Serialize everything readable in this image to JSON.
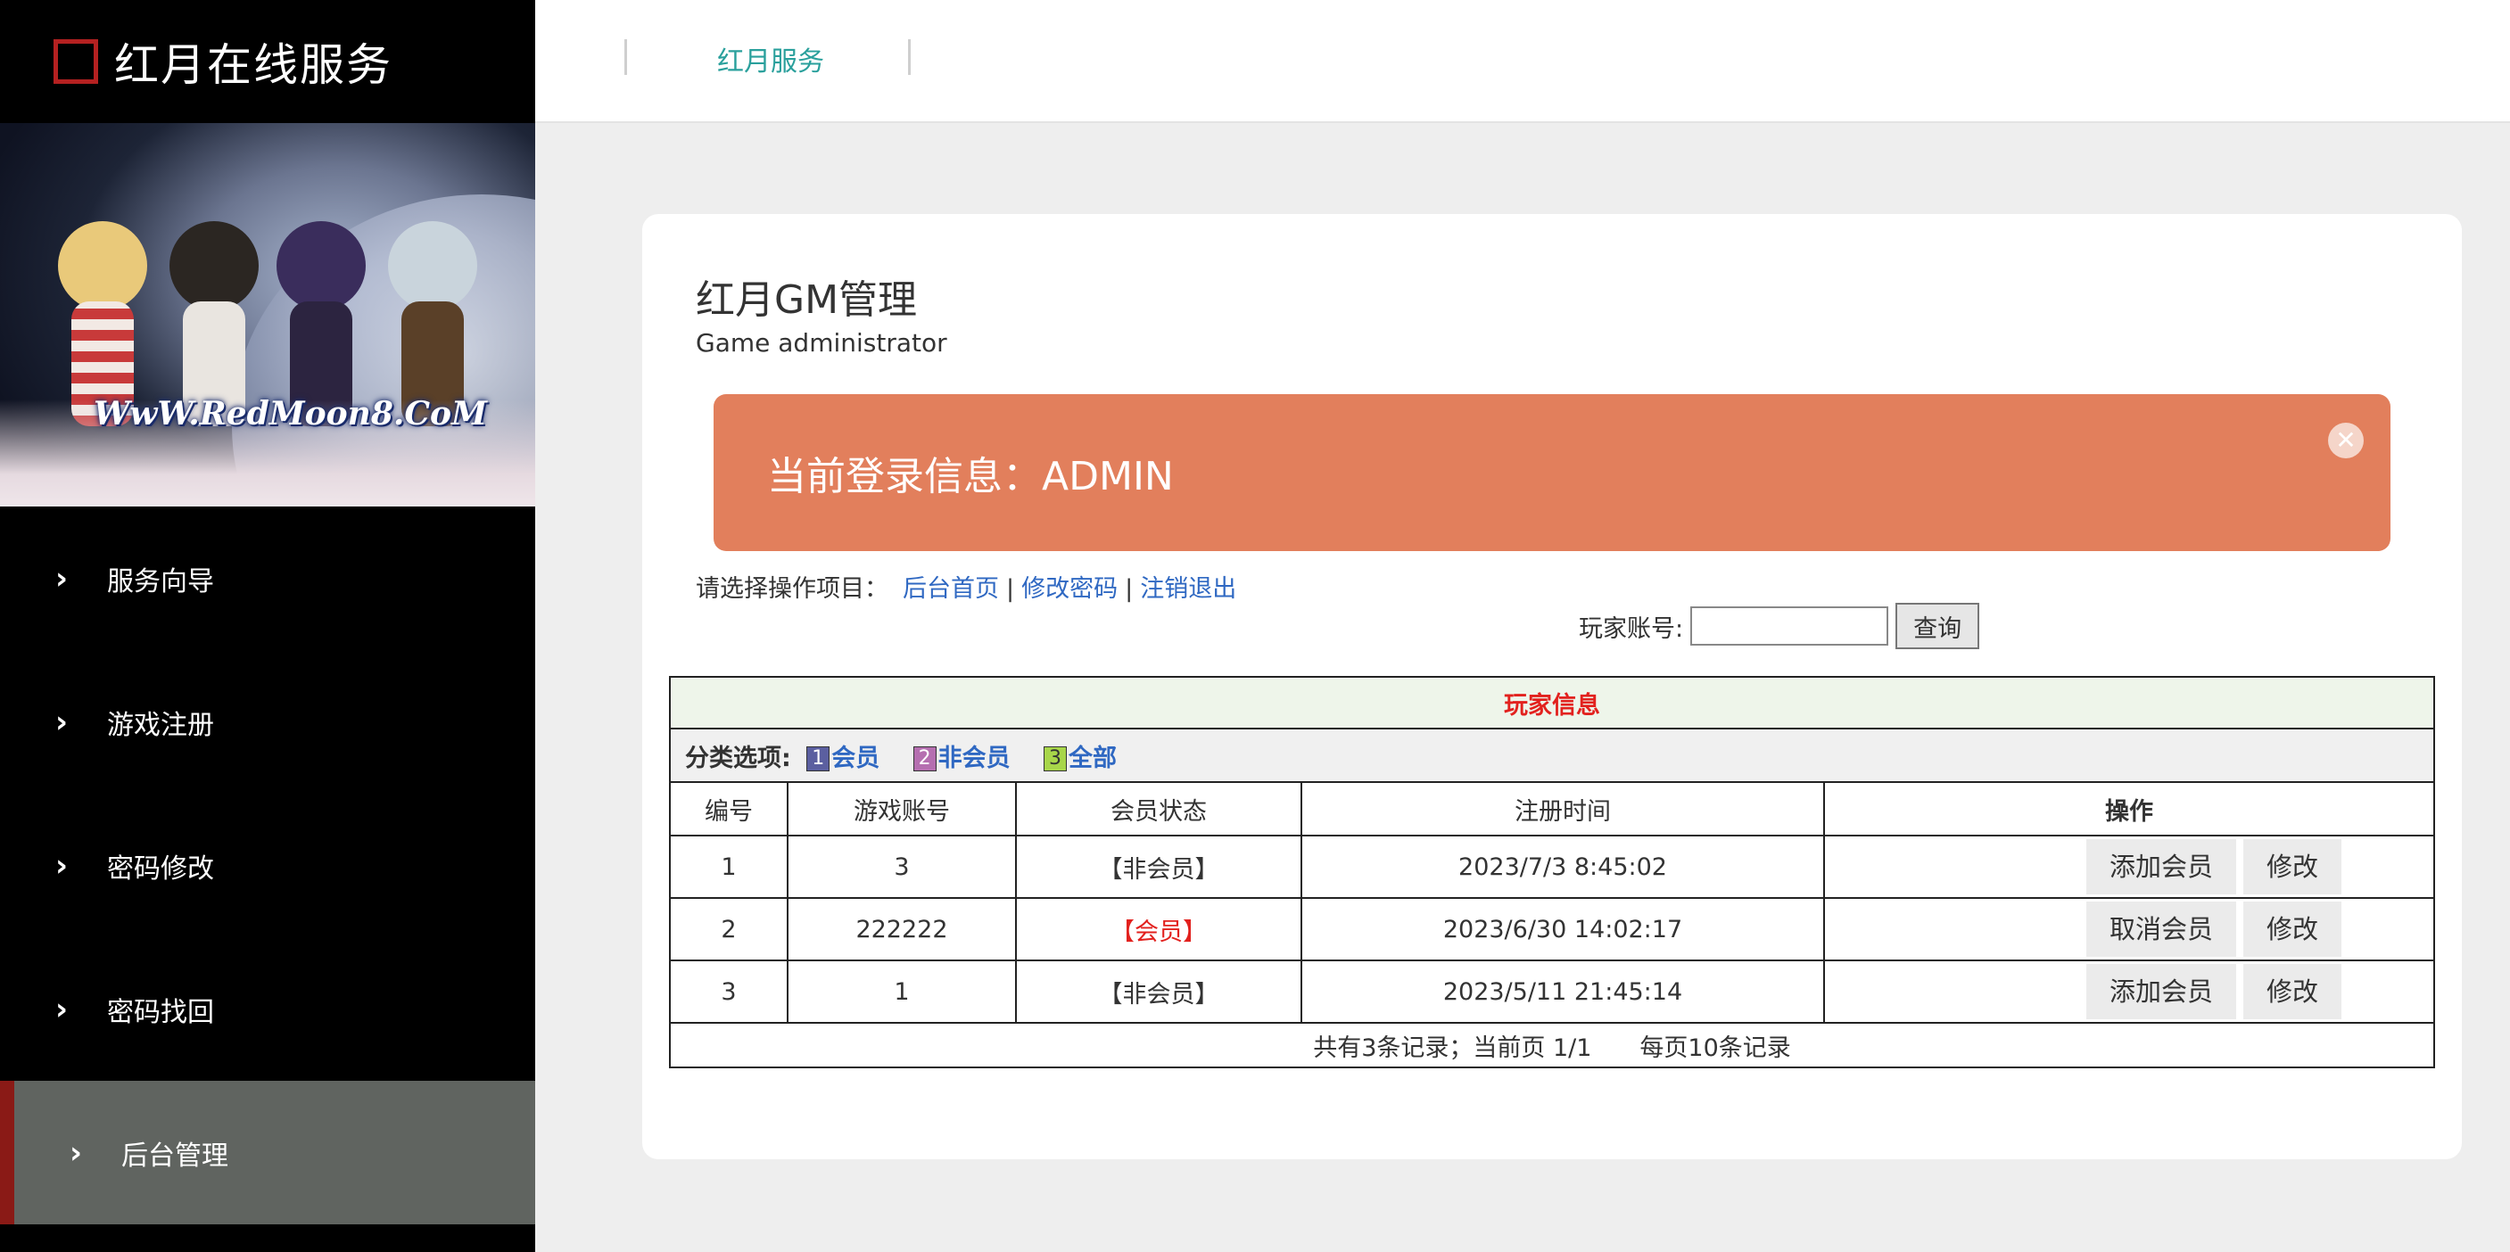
{
  "brand": {
    "title": "红月在线服务"
  },
  "banner": {
    "watermark": "WwW.RedMoon8.CoM"
  },
  "menu": {
    "items": [
      {
        "label": "服务向导",
        "active": false
      },
      {
        "label": "游戏注册",
        "active": false
      },
      {
        "label": "密码修改",
        "active": false
      },
      {
        "label": "密码找回",
        "active": false
      },
      {
        "label": "后台管理",
        "active": true
      }
    ]
  },
  "topbar": {
    "link": "红月服务"
  },
  "card": {
    "title": "红月GM管理",
    "subtitle": "Game administrator"
  },
  "alert": {
    "text": "当前登录信息：ADMIN",
    "close_icon": "close-icon"
  },
  "ops": {
    "prompt": "请选择操作项目：",
    "links": [
      "后台首页",
      "修改密码",
      "注销退出"
    ]
  },
  "search": {
    "label": "玩家账号:",
    "value": "",
    "button": "查询"
  },
  "table": {
    "caption": "玩家信息",
    "filter_label": "分类选项:",
    "filters": [
      {
        "num": "1",
        "label": "会员",
        "color": "#5b5fa0"
      },
      {
        "num": "2",
        "label": "非会员",
        "color": "#b56fb0"
      },
      {
        "num": "3",
        "label": "全部",
        "color": "#a8d64a"
      }
    ],
    "headers": [
      "编号",
      "游戏账号",
      "会员状态",
      "注册时间",
      "操作"
    ],
    "rows": [
      {
        "id": "1",
        "account": "3",
        "status": "【非会员】",
        "member": false,
        "time": "2023/7/3 8:45:02",
        "action": "添加会员",
        "edit": "修改"
      },
      {
        "id": "2",
        "account": "222222",
        "status": "【会员】",
        "member": true,
        "time": "2023/6/30 14:02:17",
        "action": "取消会员",
        "edit": "修改"
      },
      {
        "id": "3",
        "account": "1",
        "status": "【非会员】",
        "member": false,
        "time": "2023/5/11 21:45:14",
        "action": "添加会员",
        "edit": "修改"
      }
    ],
    "footer": "共有3条记录；当前页 1/1　　每页10条记录"
  },
  "colors": {
    "accent": "#2aa09c",
    "alert": "#e27f5c",
    "link": "#2f68c2",
    "red": "#e2211e",
    "sidebar_active": "#606460"
  }
}
